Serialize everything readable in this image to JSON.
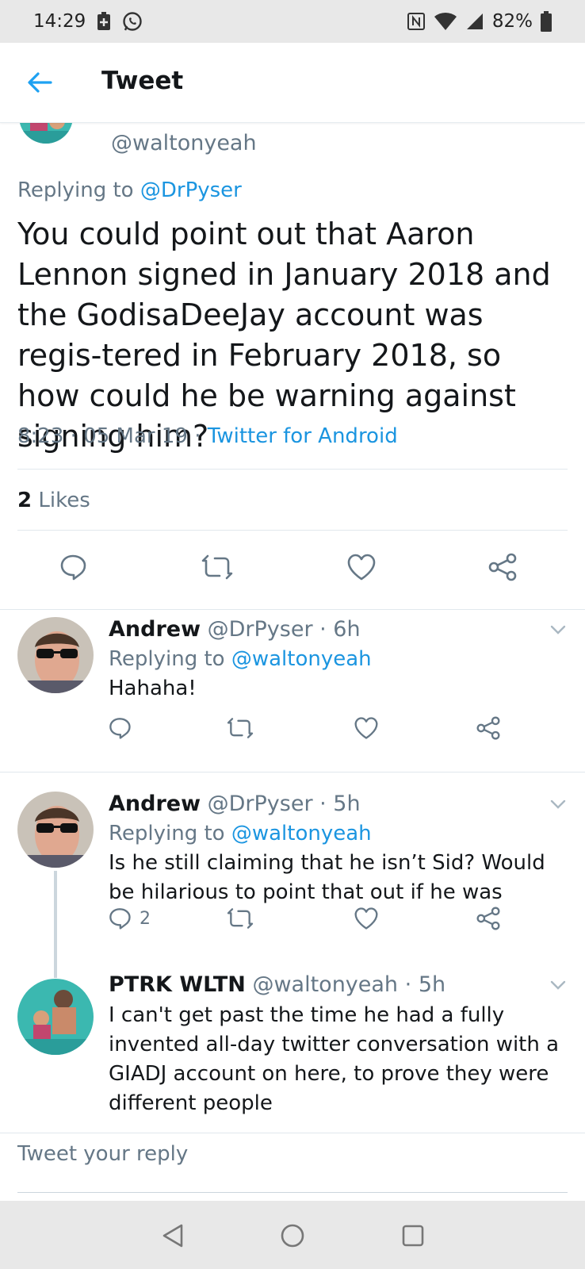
{
  "status_bar": {
    "time": "14:29",
    "battery": "82%"
  },
  "header": {
    "title": "Tweet"
  },
  "main_tweet": {
    "handle": "@waltonyeah",
    "replying_prefix": "Replying to",
    "replying_to": "@DrPyser",
    "text": "You could point out that Aaron Lennon signed in January 2018 and the GodisaDeeJay account was regis-tered in February 2018, so how could he be warning against signing him?",
    "time": "8:23",
    "date": "05 Mar 19",
    "source": "Twitter for Android",
    "likes_count": "2",
    "likes_label": "Likes"
  },
  "replies": [
    {
      "name": "Andrew",
      "handle": "@DrPyser",
      "age": "6h",
      "replying_prefix": "Replying to",
      "replying_to": "@waltonyeah",
      "text": "Hahaha!",
      "reply_count": ""
    },
    {
      "name": "Andrew",
      "handle": "@DrPyser",
      "age": "5h",
      "replying_prefix": "Replying to",
      "replying_to": "@waltonyeah",
      "text": "Is he still claiming that he isn’t Sid? Would be hilarious to point that out if he was",
      "reply_count": "2"
    },
    {
      "name": "PTRK WLTN",
      "handle": "@waltonyeah",
      "age": "5h",
      "text": "I can't get past the time he had a fully invented all-day twitter conversation with a GIADJ account on here, to prove they were different people"
    }
  ],
  "compose": {
    "placeholder": "Tweet your reply"
  },
  "colors": {
    "accent": "#1b95e0",
    "text": "#14171a",
    "secondary": "#657786",
    "divider": "#e1e8ed"
  }
}
